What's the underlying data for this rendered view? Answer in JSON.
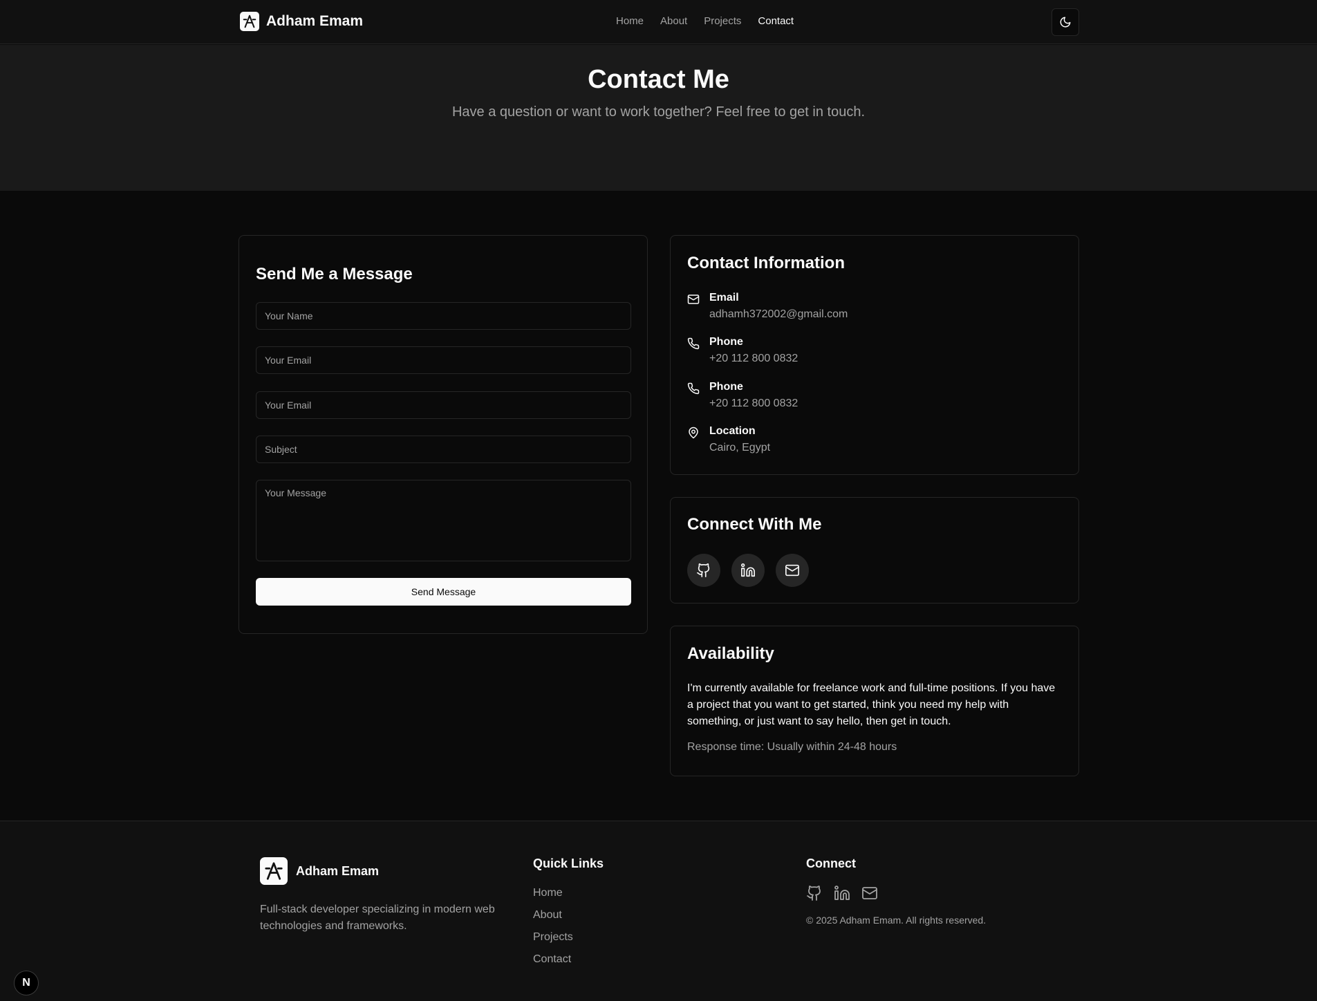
{
  "header": {
    "brand_name": "Adham Emam",
    "nav": [
      {
        "label": "Home",
        "active": false
      },
      {
        "label": "About",
        "active": false
      },
      {
        "label": "Projects",
        "active": false
      },
      {
        "label": "Contact",
        "active": true
      }
    ],
    "theme_toggle_icon": "moon-icon"
  },
  "hero": {
    "title": "Contact Me",
    "subtitle": "Have a question or want to work together? Feel free to get in touch."
  },
  "form": {
    "title": "Send Me a Message",
    "fields": [
      {
        "placeholder": "Your Name",
        "value": ""
      },
      {
        "placeholder": "Your Email",
        "value": ""
      },
      {
        "placeholder": "Your Email",
        "value": ""
      },
      {
        "placeholder": "Subject",
        "value": ""
      }
    ],
    "message_placeholder": "Your Message",
    "submit_label": "Send Message"
  },
  "contact_info": {
    "title": "Contact Information",
    "items": [
      {
        "icon": "mail-icon",
        "label": "Email",
        "value": "adhamh372002@gmail.com"
      },
      {
        "icon": "phone-icon",
        "label": "Phone",
        "value": "+20 112 800 0832"
      },
      {
        "icon": "phone-icon",
        "label": "Phone",
        "value": "+20 112 800 0832"
      },
      {
        "icon": "map-pin-icon",
        "label": "Location",
        "value": "Cairo, Egypt"
      }
    ]
  },
  "connect": {
    "title": "Connect With Me",
    "icons": [
      "github-icon",
      "linkedin-icon",
      "mail-icon"
    ]
  },
  "availability": {
    "title": "Availability",
    "text": "I'm currently available for freelance work and full-time positions. If you have a project that you want to get started, think you need my help with something, or just want to say hello, then get in touch.",
    "note": "Response time: Usually within 24-48 hours"
  },
  "footer": {
    "brand_name": "Adham Emam",
    "description": "Full-stack developer specializing in modern web technologies and frameworks.",
    "quick_links_title": "Quick Links",
    "links": [
      "Home",
      "About",
      "Projects",
      "Contact"
    ],
    "connect_title": "Connect",
    "copyright": "© 2025 Adham Emam. All rights reserved."
  },
  "badge": {
    "label": "N"
  },
  "colors": {
    "background": "#0a0a0a",
    "hero_background": "#1a1a1a",
    "border": "#262626",
    "text": "#fafafa",
    "muted_text": "#a3a3a3"
  }
}
